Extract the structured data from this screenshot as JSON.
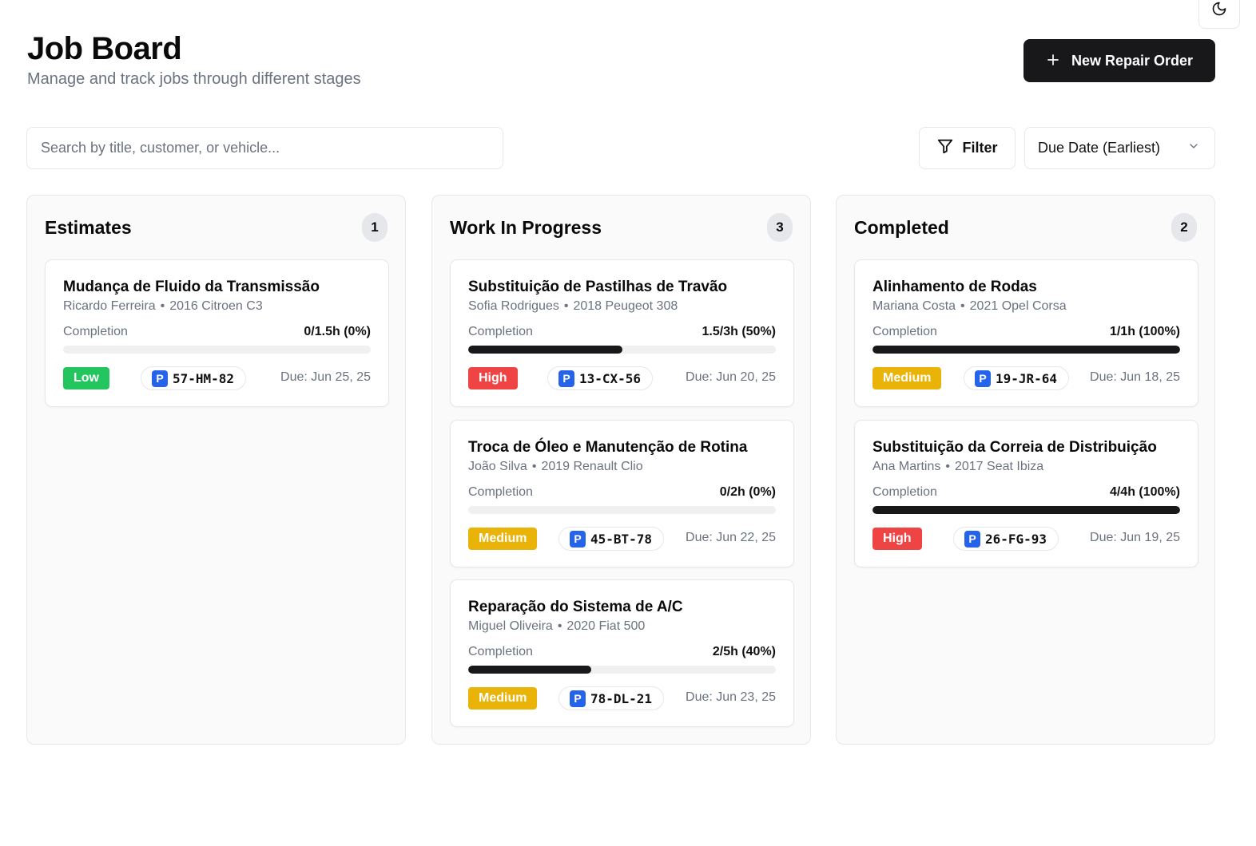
{
  "header": {
    "title": "Job Board",
    "subtitle": "Manage and track jobs through different stages",
    "new_button_label": "New Repair Order"
  },
  "toolbar": {
    "search_placeholder": "Search by title, customer, or vehicle...",
    "filter_label": "Filter",
    "sort_selected": "Due Date (Earliest)"
  },
  "icons": {
    "theme": "moon-icon",
    "new": "plus-icon",
    "filter": "funnel-icon",
    "sort": "chevron-down-icon",
    "plate": "parking-p-icon"
  },
  "colors": {
    "low": "#22c55e",
    "medium": "#eab308",
    "high": "#ef4444",
    "plate_badge": "#2563eb",
    "primary": "#18181b"
  },
  "columns": [
    {
      "title": "Estimates",
      "count": "1",
      "cards": [
        {
          "title": "Mudança de Fluido da Transmissão",
          "customer": "Ricardo Ferreira",
          "vehicle": "2016 Citroen C3",
          "completion_label": "Completion",
          "completion": "0/1.5h (0%)",
          "progress": 0,
          "priority": "Low",
          "priority_color": "#22c55e",
          "plate_prefix": "P",
          "plate": "57-HM-82",
          "due": "Due: Jun 25, 25"
        }
      ]
    },
    {
      "title": "Work In Progress",
      "count": "3",
      "cards": [
        {
          "title": "Substituição de Pastilhas de Travão",
          "customer": "Sofia Rodrigues",
          "vehicle": "2018 Peugeot 308",
          "completion_label": "Completion",
          "completion": "1.5/3h (50%)",
          "progress": 50,
          "priority": "High",
          "priority_color": "#ef4444",
          "plate_prefix": "P",
          "plate": "13-CX-56",
          "due": "Due: Jun 20, 25"
        },
        {
          "title": "Troca de Óleo e Manutenção de Rotina",
          "customer": "João Silva",
          "vehicle": "2019 Renault Clio",
          "completion_label": "Completion",
          "completion": "0/2h (0%)",
          "progress": 0,
          "priority": "Medium",
          "priority_color": "#eab308",
          "plate_prefix": "P",
          "plate": "45-BT-78",
          "due": "Due: Jun 22, 25"
        },
        {
          "title": "Reparação do Sistema de A/C",
          "customer": "Miguel Oliveira",
          "vehicle": "2020 Fiat 500",
          "completion_label": "Completion",
          "completion": "2/5h (40%)",
          "progress": 40,
          "priority": "Medium",
          "priority_color": "#eab308",
          "plate_prefix": "P",
          "plate": "78-DL-21",
          "due": "Due: Jun 23, 25"
        }
      ]
    },
    {
      "title": "Completed",
      "count": "2",
      "cards": [
        {
          "title": "Alinhamento de Rodas",
          "customer": "Mariana Costa",
          "vehicle": "2021 Opel Corsa",
          "completion_label": "Completion",
          "completion": "1/1h (100%)",
          "progress": 100,
          "priority": "Medium",
          "priority_color": "#eab308",
          "plate_prefix": "P",
          "plate": "19-JR-64",
          "due": "Due: Jun 18, 25"
        },
        {
          "title": "Substituição da Correia de Distribuição",
          "customer": "Ana Martins",
          "vehicle": "2017 Seat Ibiza",
          "completion_label": "Completion",
          "completion": "4/4h (100%)",
          "progress": 100,
          "priority": "High",
          "priority_color": "#ef4444",
          "plate_prefix": "P",
          "plate": "26-FG-93",
          "due": "Due: Jun 19, 25"
        }
      ]
    }
  ]
}
